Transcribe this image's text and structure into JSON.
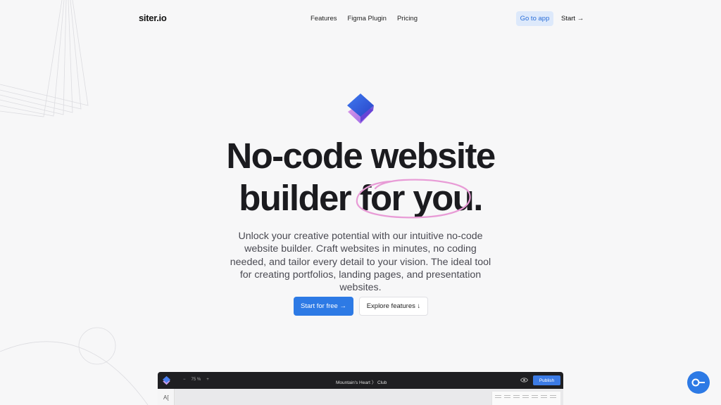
{
  "nav": {
    "logo": "siter.io",
    "links": [
      "Features",
      "Figma Plugin",
      "Pricing"
    ],
    "go_to_app": "Go to app",
    "start": "Start →"
  },
  "hero": {
    "headline_line1": "No-code website",
    "headline_line2_a": "builder ",
    "headline_line2_b": "for you",
    "headline_line2_c": ".",
    "subtext": "Unlock your creative potential with our intuitive no-code website builder. Craft websites in minutes, no coding needed, and tailor every detail to your vision. The ideal tool for creating portfolios, landing pages, and presentation websites.",
    "cta_primary": "Start for free →",
    "cta_secondary": "Explore features ↓"
  },
  "preview": {
    "zoom_minus": "−",
    "zoom_value": "75 %",
    "zoom_plus": "+",
    "breadcrumb": "Mountain's Heart 〉 Club",
    "publish": "Publish",
    "text_tool": "A["
  },
  "colors": {
    "accent": "#2d7ae5",
    "headline": "#1b1b1f",
    "highlight_circle": "#e89bd6"
  },
  "icons": [
    "siter-logo-icon",
    "eye-icon",
    "chat-icon"
  ]
}
